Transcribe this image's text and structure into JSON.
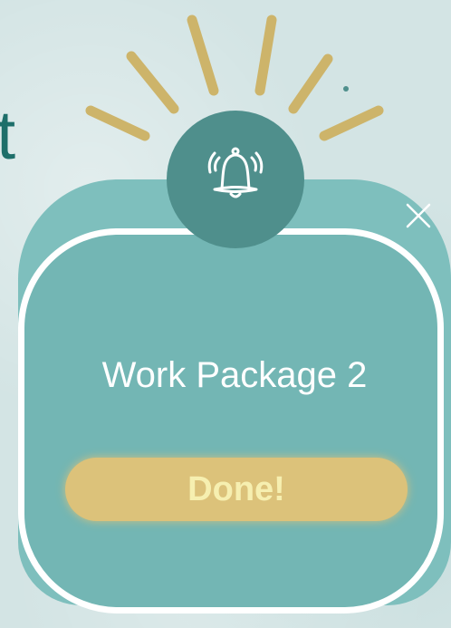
{
  "background": {
    "partial_title": "t"
  },
  "dialog": {
    "title": "Work Package 2",
    "done_label": "Done!",
    "icon": "bell-ringing-icon",
    "close_icon": "close-icon"
  },
  "colors": {
    "background": "#d3e4e4",
    "card": "#73b6b4",
    "card_back": "#7ebfbd",
    "bell_circle": "#4f8f8c",
    "rays": "#cdb46a",
    "button": "#dcc27a",
    "button_text": "#f6efb0",
    "title_text": "#ffffff",
    "bg_title_text": "#1e6f6a"
  }
}
